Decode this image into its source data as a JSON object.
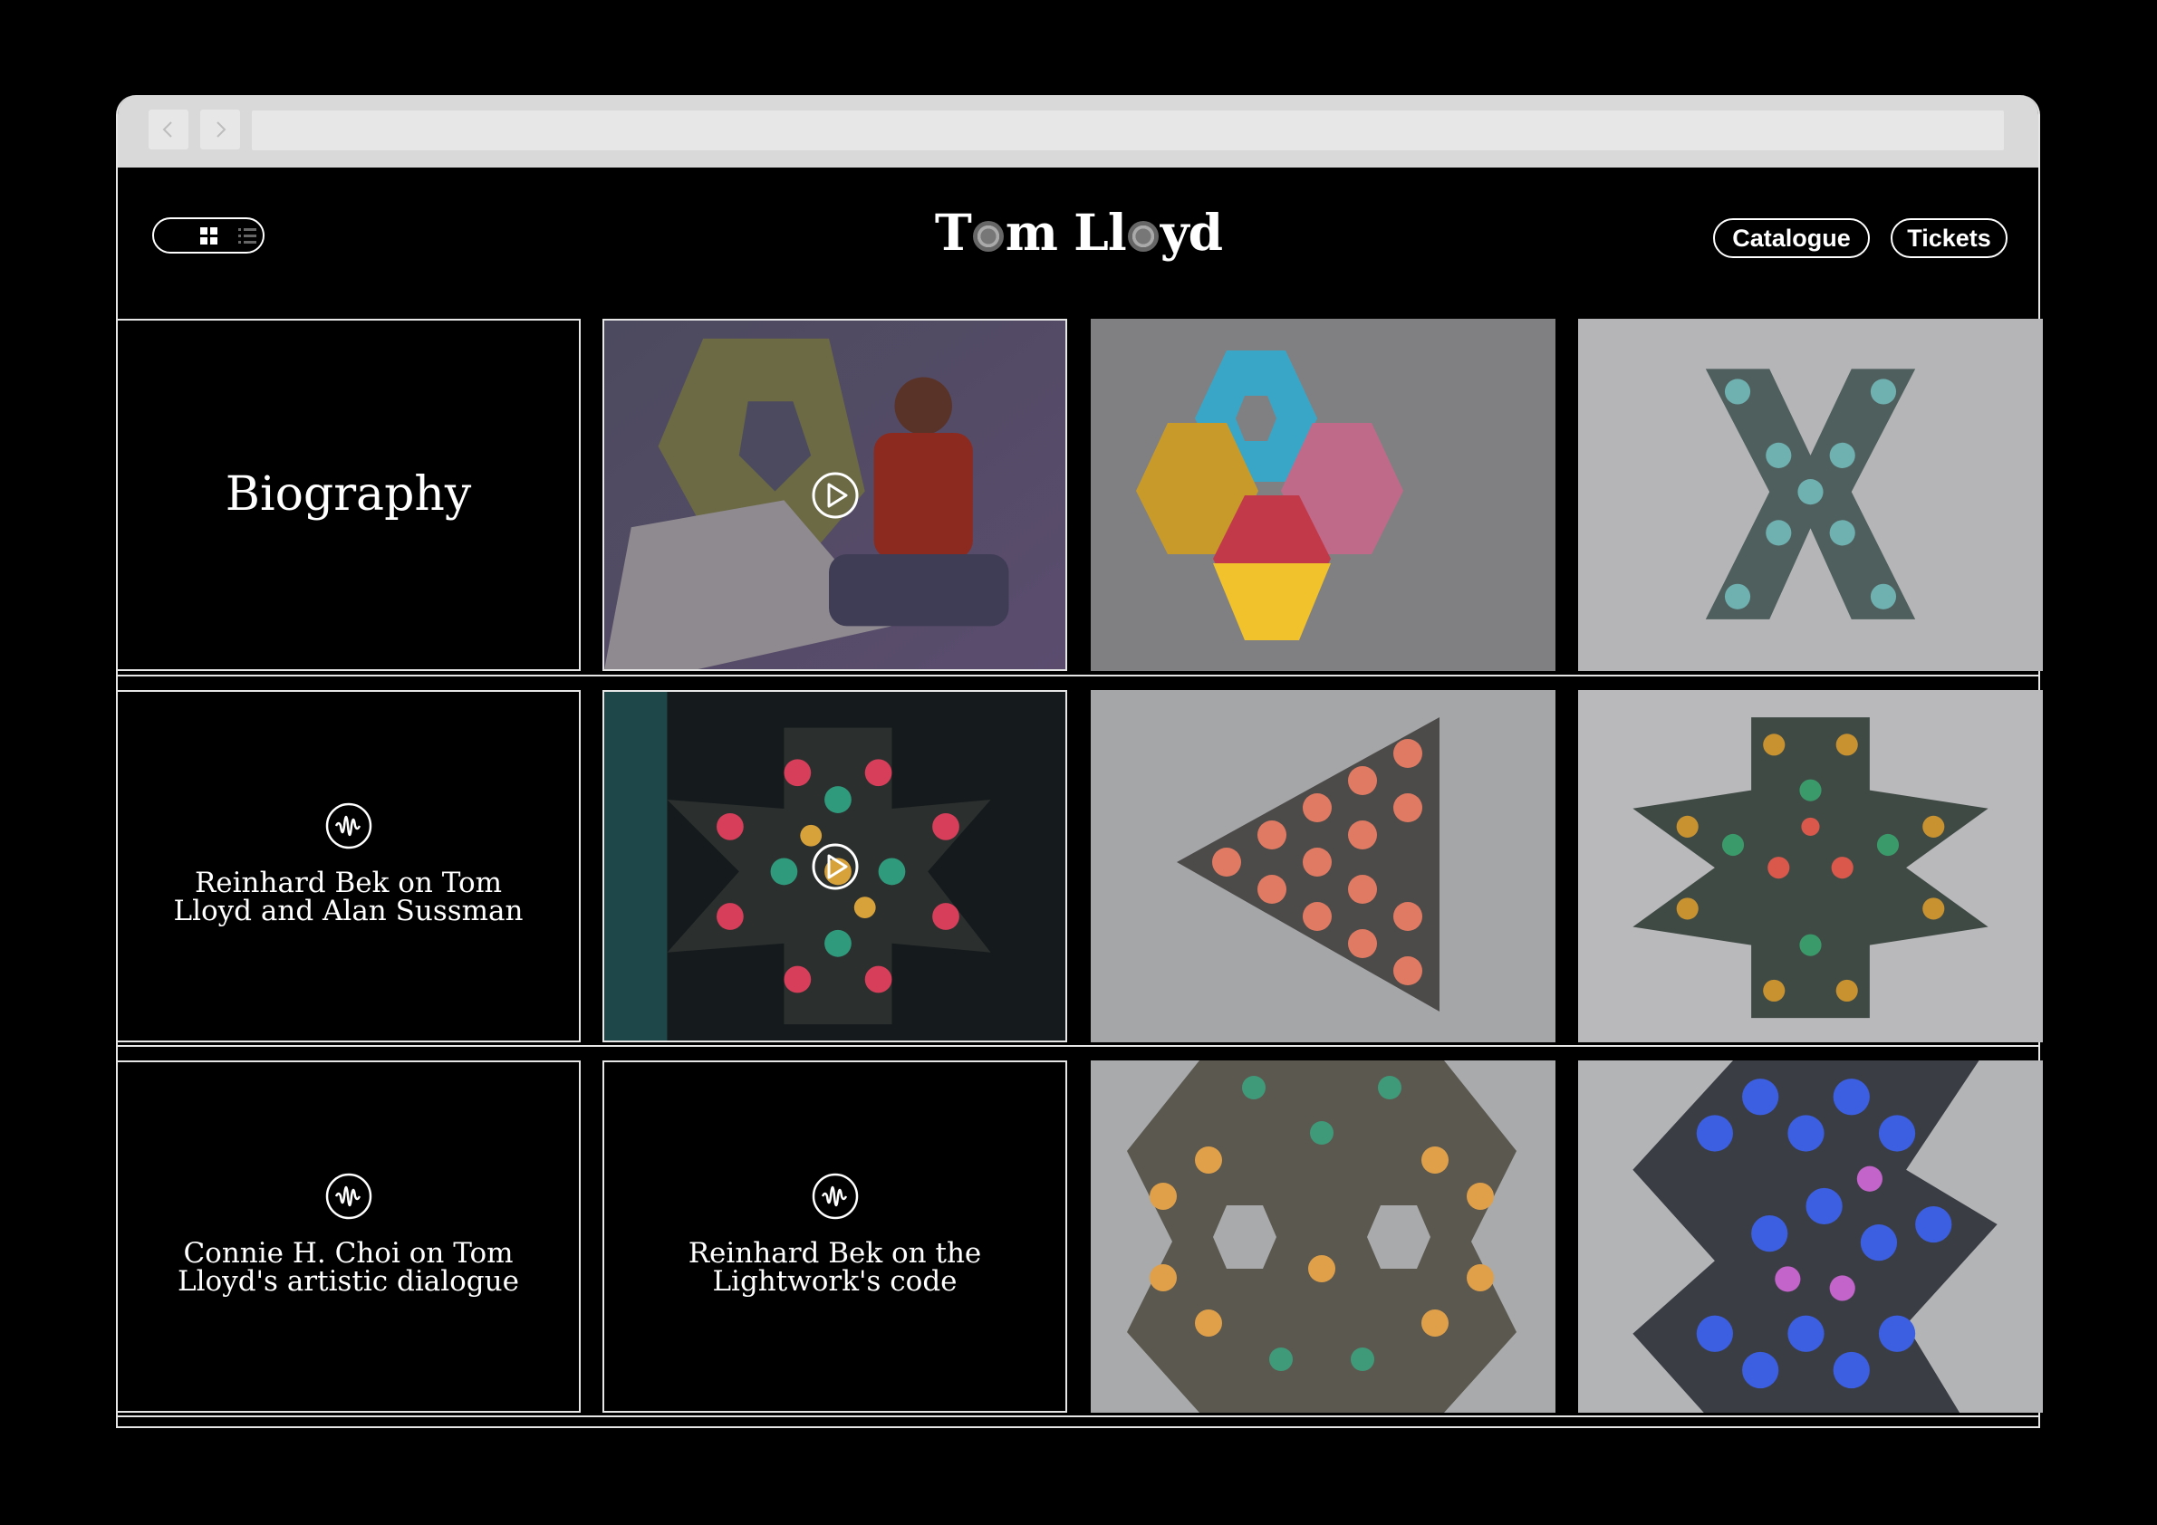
{
  "header": {
    "logo": "Tom Lloyd",
    "logo_part1": "T",
    "logo_part2": "m Ll",
    "logo_part3": "yd",
    "catalogue_label": "Catalogue",
    "tickets_label": "Tickets"
  },
  "grid": {
    "biography_title": "Biography",
    "audio_items": [
      {
        "title": "Reinhard Bek on Tom Lloyd and Alan Sussman"
      },
      {
        "title": "Connie H. Choi on Tom Lloyd's artistic dialogue"
      },
      {
        "title": "Reinhard Bek on the Lightwork's code"
      }
    ]
  },
  "icons": [
    "chevron-left-icon",
    "chevron-right-icon",
    "grid-view-icon",
    "list-view-icon",
    "play-icon",
    "audio-wave-icon"
  ],
  "colors": {
    "background": "#000000",
    "border": "#e6e6e6",
    "artwork_wall": "#8c8c8c"
  }
}
